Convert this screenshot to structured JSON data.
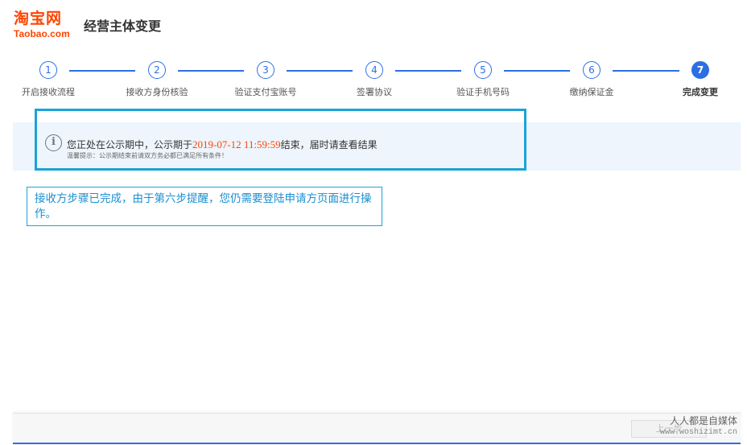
{
  "header": {
    "logo_cn": "淘宝网",
    "logo_en": "Taobao.com",
    "title": "经营主体变更"
  },
  "steps": [
    {
      "number": "1",
      "label": "开启接收流程"
    },
    {
      "number": "2",
      "label": "接收方身份核验"
    },
    {
      "number": "3",
      "label": "验证支付宝账号"
    },
    {
      "number": "4",
      "label": "签署协议"
    },
    {
      "number": "5",
      "label": "验证手机号码"
    },
    {
      "number": "6",
      "label": "缴纳保证金"
    },
    {
      "number": "7",
      "label": "完成变更"
    }
  ],
  "current_step": "7",
  "notice": {
    "icon": "info-icon",
    "text_before": "您正处在公示期中，公示期于",
    "date": "2019-07-12 11:59:59",
    "text_after": "结束，届时请查看结果",
    "tip": "温馨提示：公示期结束前请双方务必都已满足所有条件！"
  },
  "callout": {
    "text": "接收方步骤已完成，由于第六步提醒，您仍需要登陆申请方页面进行操作。"
  },
  "footer": {
    "prev_label": "上一步"
  },
  "watermark": {
    "cn": "人人都是自媒体",
    "en": "www.woshizimt.cn"
  },
  "colors": {
    "brand": "#ff4400",
    "step_blue": "#2d6fe3",
    "highlight_border": "#1aa3d8",
    "notice_bg": "#eef5fc"
  }
}
